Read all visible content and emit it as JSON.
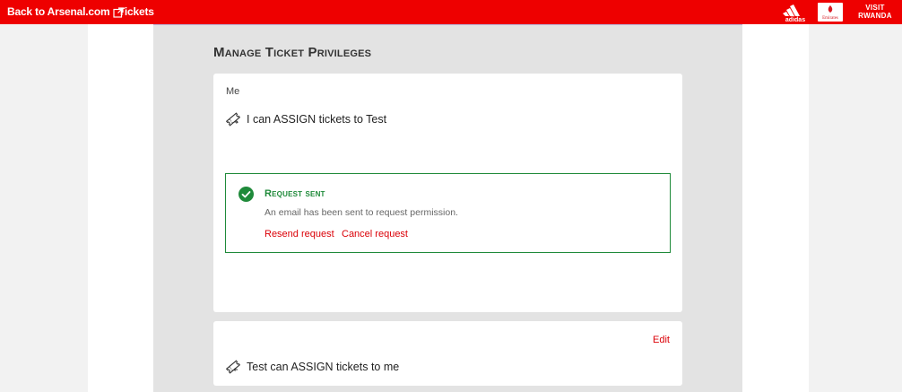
{
  "topbar": {
    "back_label": "Back to Arsenal.com",
    "tickets_label": "Tickets",
    "sponsors": {
      "adidas_text": "adidas",
      "emirates_text": "Emirates",
      "visit_rwanda_line1": "VISIT",
      "visit_rwanda_line2": "RWANDA"
    }
  },
  "page": {
    "title": "Manage Ticket Privileges"
  },
  "card_me": {
    "owner_label": "Me",
    "privilege_text": "I can ASSIGN tickets to Test",
    "status": {
      "title": "Request sent",
      "description": "An email has been sent to request permission.",
      "resend_label": "Resend request",
      "cancel_label": "Cancel request"
    }
  },
  "card_test": {
    "edit_label": "Edit",
    "privilege_text": "Test can ASSIGN tickets to me"
  },
  "colors": {
    "brand_red": "#ee0000",
    "success_green": "#1f8a3a",
    "link_red": "#db0007"
  }
}
